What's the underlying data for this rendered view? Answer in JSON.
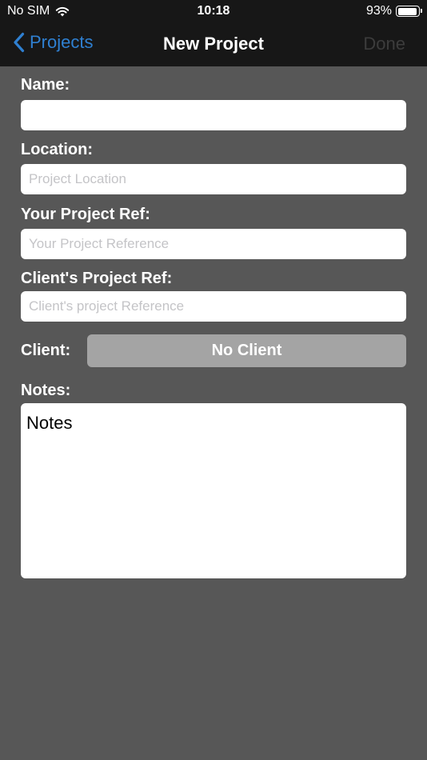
{
  "status_bar": {
    "carrier": "No SIM",
    "time": "10:18",
    "battery_percent": "93%",
    "battery_level": 0.93
  },
  "nav": {
    "back_label": "Projects",
    "title": "New Project",
    "done_label": "Done"
  },
  "form": {
    "name": {
      "label": "Name:",
      "value": "",
      "placeholder": ""
    },
    "location": {
      "label": "Location:",
      "value": "",
      "placeholder": "Project Location"
    },
    "your_ref": {
      "label": "Your Project Ref:",
      "value": "",
      "placeholder": "Your Project Reference"
    },
    "client_ref": {
      "label": "Client's Project Ref:",
      "value": "",
      "placeholder": "Client's project Reference"
    },
    "client": {
      "label": "Client:",
      "button_label": "No Client"
    },
    "notes": {
      "label": "Notes:",
      "value": "Notes"
    }
  },
  "colors": {
    "background": "#575757",
    "bar": "#171717",
    "accent": "#2f80d1",
    "done_disabled": "#3c3c3c",
    "client_button": "#a4a4a4"
  },
  "icons": {
    "wifi": "wifi-icon",
    "battery": "battery-icon",
    "back": "chevron-left-icon"
  }
}
